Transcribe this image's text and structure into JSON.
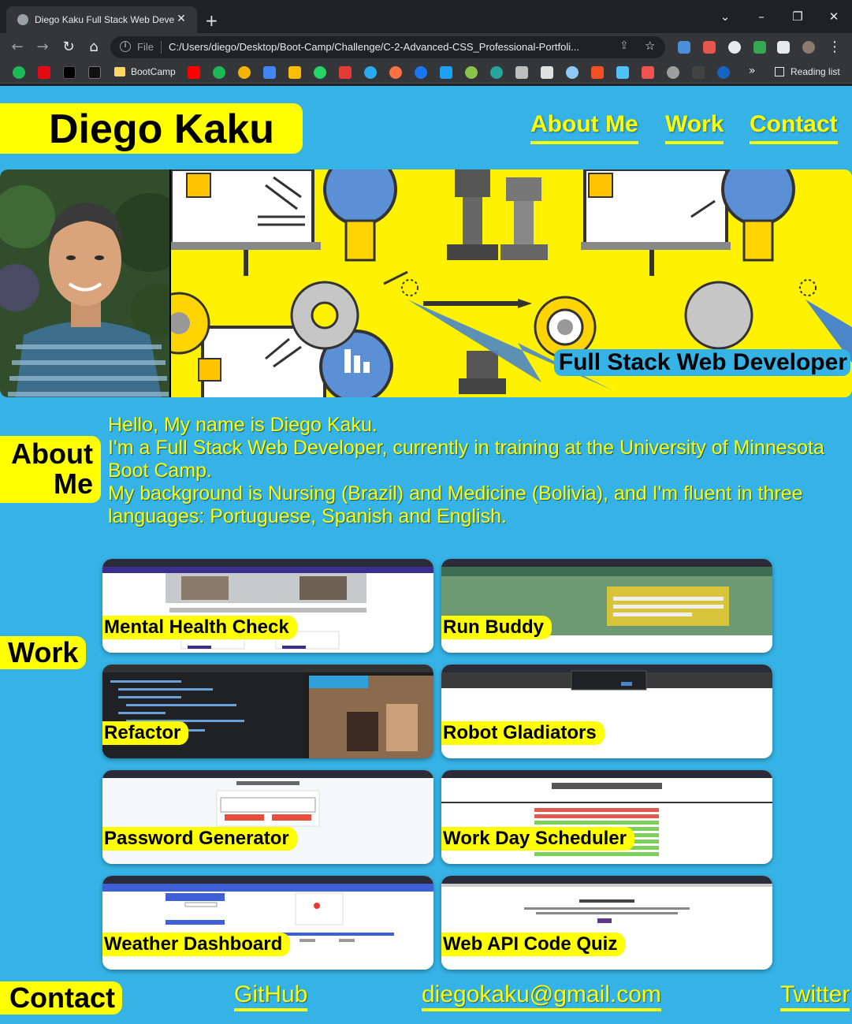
{
  "browser": {
    "tab_title": "Diego Kaku Full Stack Web Devel",
    "new_tab_label": "+",
    "address_scheme": "File",
    "address_url": "C:/Users/diego/Desktop/Boot-Camp/Challenge/C-2-Advanced-CSS_Professional-Portfoli...",
    "bookmark_folder": "BootCamp",
    "bookmark_more": "»",
    "reading_list": "Reading list"
  },
  "header": {
    "name": "Diego Kaku",
    "nav": [
      "About Me",
      "Work",
      "Contact"
    ]
  },
  "hero": {
    "tagline": "Full Stack Web Developer"
  },
  "about": {
    "heading_line1": "About",
    "heading_line2": "Me",
    "lines": [
      "Hello, My name is Diego Kaku.",
      "I'm a Full Stack Web Developer, currently in training at the University of Minnesota Boot Camp.",
      "My background is Nursing (Brazil) and Medicine (Bolivia), and I'm fluent in three languages: Portuguese, Spanish and English."
    ]
  },
  "work": {
    "heading": "Work",
    "projects": [
      {
        "title": "Mental Health Check"
      },
      {
        "title": "Run Buddy"
      },
      {
        "title": "Refactor"
      },
      {
        "title": "Robot Gladiators"
      },
      {
        "title": "Password Generator"
      },
      {
        "title": "Work Day Scheduler"
      },
      {
        "title": "Weather Dashboard"
      },
      {
        "title": "Web API Code Quiz"
      }
    ]
  },
  "contact": {
    "heading": "Contact",
    "links": [
      "GitHub",
      "diegokaku@gmail.com",
      "Twitter"
    ]
  },
  "colors": {
    "page_background": "#35b3e6",
    "accent_yellow": "#ffff00",
    "chrome_dark": "#202124"
  }
}
